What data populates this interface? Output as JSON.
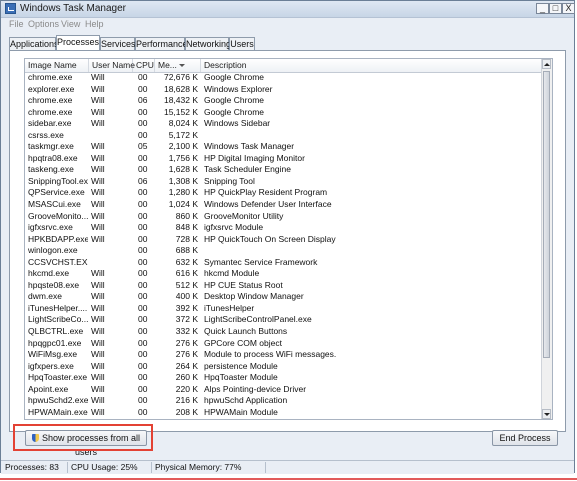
{
  "window": {
    "title": "Windows Task Manager",
    "controls": [
      "_",
      "□",
      "X"
    ]
  },
  "menu": [
    "File",
    "Options",
    "View",
    "Help"
  ],
  "tabs": [
    "Applications",
    "Processes",
    "Services",
    "Performance",
    "Networking",
    "Users"
  ],
  "active_tab": "Processes",
  "columns": [
    "Image Name",
    "User Name",
    "CPU",
    "Me...",
    "Description"
  ],
  "processes": [
    {
      "name": "chrome.exe",
      "user": "Will",
      "cpu": "00",
      "mem": "72,676 K",
      "desc": "Google Chrome"
    },
    {
      "name": "explorer.exe",
      "user": "Will",
      "cpu": "00",
      "mem": "18,628 K",
      "desc": "Windows Explorer"
    },
    {
      "name": "chrome.exe",
      "user": "Will",
      "cpu": "06",
      "mem": "18,432 K",
      "desc": "Google Chrome"
    },
    {
      "name": "chrome.exe",
      "user": "Will",
      "cpu": "00",
      "mem": "15,152 K",
      "desc": "Google Chrome"
    },
    {
      "name": "sidebar.exe",
      "user": "Will",
      "cpu": "00",
      "mem": "8,024 K",
      "desc": "Windows Sidebar"
    },
    {
      "name": "csrss.exe",
      "user": "",
      "cpu": "00",
      "mem": "5,172 K",
      "desc": ""
    },
    {
      "name": "taskmgr.exe",
      "user": "Will",
      "cpu": "05",
      "mem": "2,100 K",
      "desc": "Windows Task Manager"
    },
    {
      "name": "hpqtra08.exe",
      "user": "Will",
      "cpu": "00",
      "mem": "1,756 K",
      "desc": "HP Digital Imaging Monitor"
    },
    {
      "name": "taskeng.exe",
      "user": "Will",
      "cpu": "00",
      "mem": "1,628 K",
      "desc": "Task Scheduler Engine"
    },
    {
      "name": "SnippingTool.exe",
      "user": "Will",
      "cpu": "06",
      "mem": "1,308 K",
      "desc": "Snipping Tool"
    },
    {
      "name": "QPService.exe",
      "user": "Will",
      "cpu": "00",
      "mem": "1,280 K",
      "desc": "HP QuickPlay Resident Program"
    },
    {
      "name": "MSASCui.exe",
      "user": "Will",
      "cpu": "00",
      "mem": "1,024 K",
      "desc": "Windows Defender User Interface"
    },
    {
      "name": "GrooveMonito...",
      "user": "Will",
      "cpu": "00",
      "mem": "860 K",
      "desc": "GrooveMonitor Utility"
    },
    {
      "name": "igfxsrvc.exe",
      "user": "Will",
      "cpu": "00",
      "mem": "848 K",
      "desc": "igfxsrvc Module"
    },
    {
      "name": "HPKBDAPP.exe",
      "user": "Will",
      "cpu": "00",
      "mem": "728 K",
      "desc": "HP QuickTouch On Screen Display"
    },
    {
      "name": "winlogon.exe",
      "user": "",
      "cpu": "00",
      "mem": "688 K",
      "desc": ""
    },
    {
      "name": "CCSVCHST.EXE",
      "user": "",
      "cpu": "00",
      "mem": "632 K",
      "desc": "Symantec Service Framework"
    },
    {
      "name": "hkcmd.exe",
      "user": "Will",
      "cpu": "00",
      "mem": "616 K",
      "desc": "hkcmd Module"
    },
    {
      "name": "hpqste08.exe",
      "user": "Will",
      "cpu": "00",
      "mem": "512 K",
      "desc": "HP CUE Status Root"
    },
    {
      "name": "dwm.exe",
      "user": "Will",
      "cpu": "00",
      "mem": "400 K",
      "desc": "Desktop Window Manager"
    },
    {
      "name": "iTunesHelper....",
      "user": "Will",
      "cpu": "00",
      "mem": "392 K",
      "desc": "iTunesHelper"
    },
    {
      "name": "LightScribeCo...",
      "user": "Will",
      "cpu": "00",
      "mem": "372 K",
      "desc": "LightScribeControlPanel.exe"
    },
    {
      "name": "QLBCTRL.exe",
      "user": "Will",
      "cpu": "00",
      "mem": "332 K",
      "desc": "Quick Launch Buttons"
    },
    {
      "name": "hpqgpc01.exe",
      "user": "Will",
      "cpu": "00",
      "mem": "276 K",
      "desc": "GPCore COM object"
    },
    {
      "name": "WiFiMsg.exe",
      "user": "Will",
      "cpu": "00",
      "mem": "276 K",
      "desc": "Module to process WiFi messages."
    },
    {
      "name": "igfxpers.exe",
      "user": "Will",
      "cpu": "00",
      "mem": "264 K",
      "desc": "persistence Module"
    },
    {
      "name": "HpqToaster.exe",
      "user": "Will",
      "cpu": "00",
      "mem": "260 K",
      "desc": "HpqToaster Module"
    },
    {
      "name": "Apoint.exe",
      "user": "Will",
      "cpu": "00",
      "mem": "220 K",
      "desc": "Alps Pointing-device Driver"
    },
    {
      "name": "hpwuSchd2.exe",
      "user": "Will",
      "cpu": "00",
      "mem": "216 K",
      "desc": "hpwuSchd Application"
    },
    {
      "name": "HPWAMain.exe",
      "user": "Will",
      "cpu": "00",
      "mem": "208 K",
      "desc": "HPWAMain Module"
    }
  ],
  "buttons": {
    "show_all": "Show processes from all users",
    "end_process": "End Process"
  },
  "status": {
    "processes": "Processes: 83",
    "cpu": "CPU Usage: 25%",
    "memory": "Physical Memory: 77%"
  },
  "colors": {
    "highlight_border": "#e34234",
    "window_frame": "#e9eef5"
  }
}
